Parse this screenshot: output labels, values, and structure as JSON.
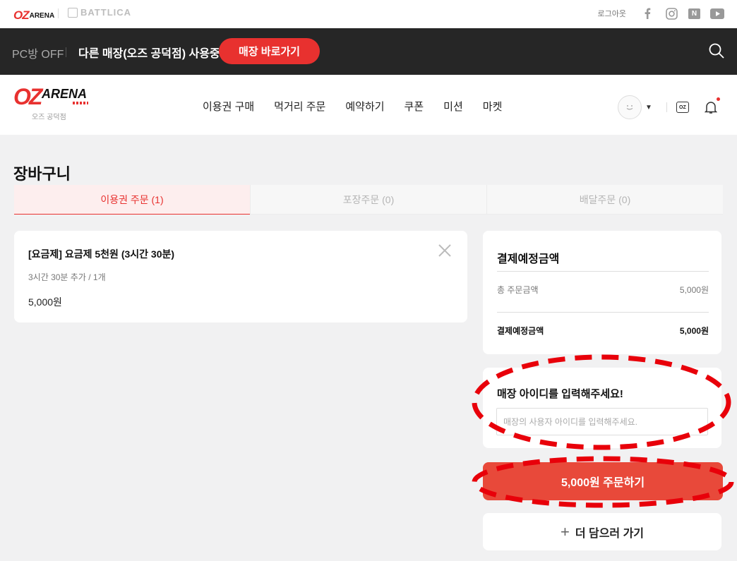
{
  "topbar": {
    "brand_small_mark": "OZ",
    "brand_small_word": "ARENA",
    "partner_logo": "BATTLICA",
    "logout": "로그아웃",
    "sns_icons": [
      "facebook-icon",
      "instagram-icon",
      "naver-icon",
      "youtube-icon"
    ],
    "naver_letter": "N"
  },
  "statusbar": {
    "pc_status": "PC방 OFF",
    "using_text": "다른 매장(오즈 공덕점) 사용중",
    "goto_button": "매장 바로가기"
  },
  "header": {
    "logo_mark": "OZ",
    "logo_word": "ARENA",
    "store_name": "오즈 공덕점",
    "nav": [
      "이용권 구매",
      "먹거리 주문",
      "예약하기",
      "쿠폰",
      "미션",
      "마켓"
    ],
    "oz_icon_text": "OZ"
  },
  "page": {
    "title": "장바구니",
    "tabs": [
      {
        "label": "이용권 주문 (1)",
        "active": true
      },
      {
        "label": "포장주문 (0)",
        "active": false
      },
      {
        "label": "배달주문 (0)",
        "active": false
      }
    ]
  },
  "cart": {
    "item_name": "[요금제] 요금제 5천원 (3시간 30분)",
    "item_option": "3시간 30분 추가 / 1개",
    "item_price": "5,000원"
  },
  "summary": {
    "title": "결제예정금액",
    "total_label": "총 주문금액",
    "total_value": "5,000원",
    "pay_label": "결제예정금액",
    "pay_value": "5,000원"
  },
  "store_id": {
    "title": "매장 아이디를 입력해주세요!",
    "placeholder": "매장의 사용자 아이디를 입력해주세요.",
    "value": ""
  },
  "actions": {
    "order_button": "5,000원 주문하기",
    "more_button": "더 담으러 가기",
    "more_icon": "+"
  },
  "colors": {
    "accent": "#e8312f",
    "order_button": "#e8493a",
    "annotation": "#e8000a"
  }
}
